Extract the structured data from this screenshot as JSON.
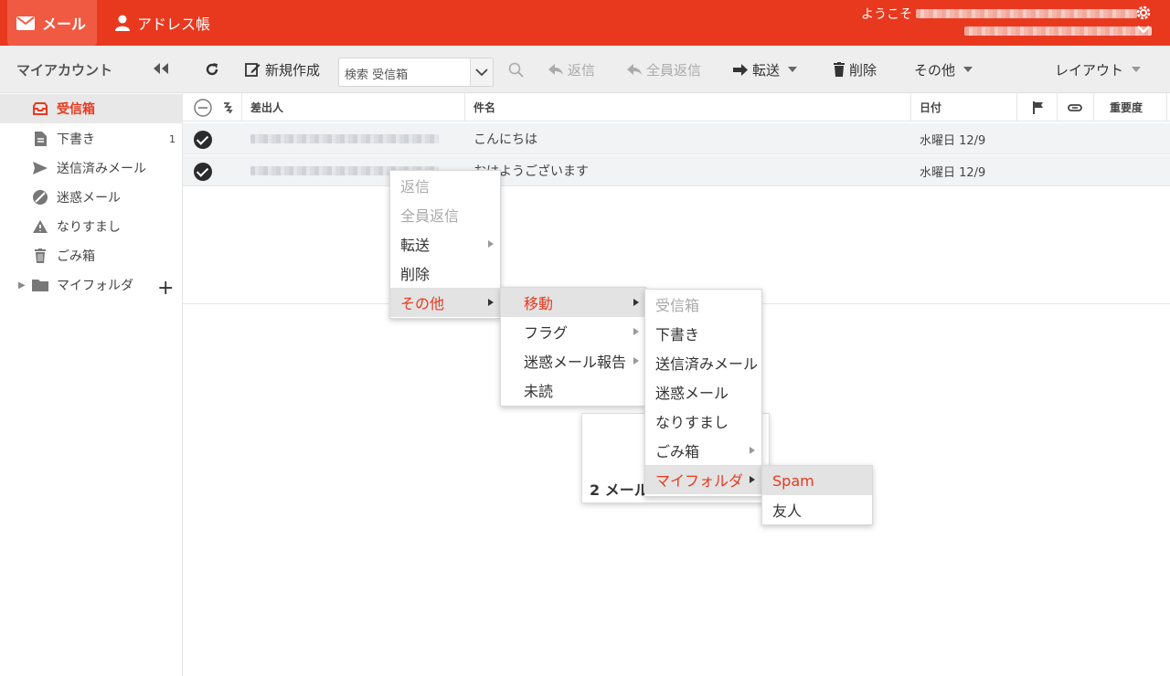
{
  "header": {
    "mail_tab": "メール",
    "address_tab": "アドレス帳",
    "welcome": "ようこそ"
  },
  "sidebar": {
    "title": "マイアカウント",
    "items": [
      {
        "label": "受信箱",
        "icon": "inbox-icon"
      },
      {
        "label": "下書き",
        "icon": "draft-icon",
        "count": "1"
      },
      {
        "label": "送信済みメール",
        "icon": "send-icon"
      },
      {
        "label": "迷惑メール",
        "icon": "spam-icon"
      },
      {
        "label": "なりすまし",
        "icon": "warning-icon"
      },
      {
        "label": "ごみ箱",
        "icon": "trash-icon"
      },
      {
        "label": "マイフォルダ",
        "icon": "folder-icon"
      }
    ]
  },
  "toolbar": {
    "new": "新規作成",
    "search_placeholder": "検索 受信箱",
    "reply": "返信",
    "reply_all": "全員返信",
    "forward": "転送",
    "delete": "削除",
    "more": "その他",
    "layout": "レイアウト"
  },
  "table": {
    "headers": {
      "from": "差出人",
      "subject": "件名",
      "date": "日付",
      "priority": "重要度"
    },
    "rows": [
      {
        "subject": "こんにちは",
        "date": "水曜日 12/9"
      },
      {
        "subject": "おはようございます",
        "date": "水曜日 12/9"
      }
    ]
  },
  "context_menu": {
    "items": [
      "返信",
      "全員返信",
      "転送",
      "削除",
      "その他"
    ]
  },
  "submenu_more": {
    "items": [
      "移動",
      "フラグ",
      "迷惑メール報告",
      "未読"
    ]
  },
  "submenu_move": {
    "items": [
      "受信箱",
      "下書き",
      "送信済みメール",
      "迷惑メール",
      "なりすまし",
      "ごみ箱",
      "マイフォルダ"
    ]
  },
  "submenu_folders": {
    "items": [
      "Spam",
      "友人"
    ]
  },
  "popup": {
    "text": "2 メール"
  },
  "colors": {
    "brand": "#e8391f",
    "highlight": "#e3e3e3"
  }
}
